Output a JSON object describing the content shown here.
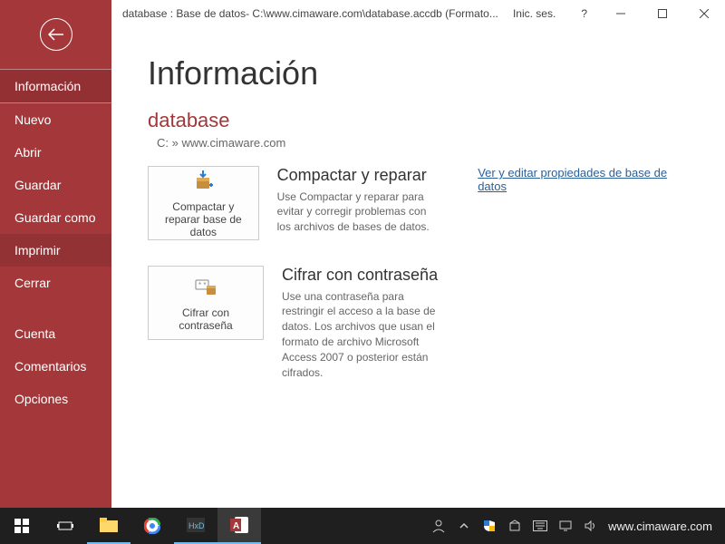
{
  "titlebar": {
    "title": "database : Base de datos- C:\\www.cimaware.com\\database.accdb (Formato...",
    "signin": "Inic. ses.",
    "help": "?"
  },
  "sidebar": {
    "items": [
      {
        "label": "Información",
        "selected": true
      },
      {
        "label": "Nuevo"
      },
      {
        "label": "Abrir"
      },
      {
        "label": "Guardar"
      },
      {
        "label": "Guardar como"
      },
      {
        "label": "Imprimir",
        "highlight": true
      },
      {
        "label": "Cerrar"
      }
    ],
    "footer": [
      {
        "label": "Cuenta"
      },
      {
        "label": "Comentarios"
      },
      {
        "label": "Opciones"
      }
    ]
  },
  "main": {
    "heading": "Información",
    "dbname": "database",
    "dbpath": "C: » www.cimaware.com",
    "link": "Ver y editar propiedades de base de datos",
    "compact": {
      "button": "Compactar y reparar base de datos",
      "title": "Compactar y reparar",
      "desc": "Use Compactar y reparar para evitar y corregir problemas con los archivos de bases de datos."
    },
    "encrypt": {
      "button": "Cifrar con contraseña",
      "title": "Cifrar con contraseña",
      "desc": "Use una contraseña para restringir el acceso a la base de datos. Los archivos que usan el formato de archivo Microsoft Access 2007 o posterior están cifrados."
    }
  },
  "taskbar": {
    "brand": "www.cimaware.com"
  }
}
